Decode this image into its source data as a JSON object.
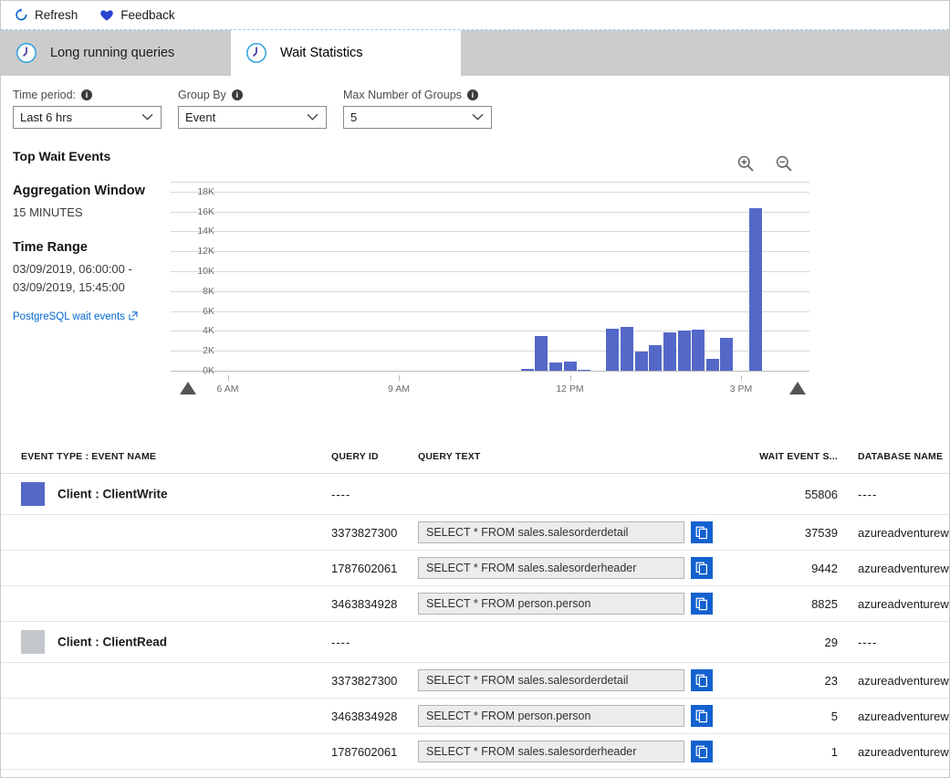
{
  "commandbar": {
    "refresh_label": "Refresh",
    "feedback_label": "Feedback"
  },
  "tabs": [
    {
      "label": "Long running queries",
      "icon": "clock-icon",
      "active": false
    },
    {
      "label": "Wait Statistics",
      "icon": "clock-icon",
      "active": true
    }
  ],
  "filters": {
    "time_period": {
      "label": "Time period:",
      "value": "Last 6 hrs"
    },
    "group_by": {
      "label": "Group By",
      "value": "Event"
    },
    "max_groups": {
      "label": "Max Number of Groups",
      "value": "5"
    }
  },
  "left_panel": {
    "title": "Top Wait Events",
    "aggregation_heading": "Aggregation Window",
    "aggregation_value": "15 MINUTES",
    "time_range_heading": "Time Range",
    "time_range_value": "03/09/2019, 06:00:00 - 03/09/2019, 15:45:00",
    "link_label": "PostgreSQL wait events"
  },
  "chart_controls": {
    "zoom_in": "zoom-in-icon",
    "zoom_out": "zoom-out-icon"
  },
  "chart_data": {
    "type": "bar",
    "title": "Top Wait Events",
    "xlabel": "",
    "ylabel": "",
    "ylim": [
      0,
      19000
    ],
    "yticks": [
      0,
      2000,
      4000,
      6000,
      8000,
      10000,
      12000,
      14000,
      16000,
      18000
    ],
    "ytick_labels": [
      "0K",
      "2K",
      "4K",
      "6K",
      "8K",
      "10K",
      "12K",
      "14K",
      "16K",
      "18K"
    ],
    "xtick_labels": [
      "6 AM",
      "9 AM",
      "12 PM",
      "3 PM"
    ],
    "xtick_positions": [
      6,
      9,
      12,
      15
    ],
    "x_range_hours": [
      5.0,
      16.2
    ],
    "grid": true,
    "legend": false,
    "bar_color": "#5468c8",
    "series": [
      {
        "name": "Client : ClientWrite",
        "bucket_minutes": 15,
        "x": [
          11.25,
          11.5,
          11.75,
          12.0,
          12.25,
          12.75,
          13.0,
          13.25,
          13.5,
          13.75,
          14.0,
          14.25,
          14.5,
          14.75,
          15.25
        ],
        "values": [
          180,
          3450,
          850,
          950,
          60,
          4200,
          4400,
          1900,
          2600,
          3900,
          4050,
          4150,
          1200,
          3350,
          16300
        ]
      }
    ]
  },
  "table": {
    "columns": [
      "EVENT TYPE : EVENT NAME",
      "QUERY ID",
      "QUERY TEXT",
      "WAIT EVENT S...",
      "DATABASE NAME"
    ],
    "rows": [
      {
        "kind": "group",
        "swatch": "#5468c8",
        "event": "Client : ClientWrite",
        "query_id": "----",
        "query_text": "",
        "wait": "55806",
        "database": "----"
      },
      {
        "kind": "detail",
        "event": "",
        "query_id": "3373827300",
        "query_text": "SELECT * FROM sales.salesorderdetail",
        "wait": "37539",
        "database": "azureadventurewor..."
      },
      {
        "kind": "detail",
        "event": "",
        "query_id": "1787602061",
        "query_text": "SELECT * FROM sales.salesorderheader",
        "wait": "9442",
        "database": "azureadventurewor..."
      },
      {
        "kind": "detail",
        "event": "",
        "query_id": "3463834928",
        "query_text": "SELECT * FROM person.person",
        "wait": "8825",
        "database": "azureadventurewor..."
      },
      {
        "kind": "group",
        "swatch": "#c3c6cb",
        "event": "Client : ClientRead",
        "query_id": "----",
        "query_text": "",
        "wait": "29",
        "database": "----"
      },
      {
        "kind": "detail",
        "event": "",
        "query_id": "3373827300",
        "query_text": "SELECT * FROM sales.salesorderdetail",
        "wait": "23",
        "database": "azureadventurewor..."
      },
      {
        "kind": "detail",
        "event": "",
        "query_id": "3463834928",
        "query_text": "SELECT * FROM person.person",
        "wait": "5",
        "database": "azureadventurewor..."
      },
      {
        "kind": "detail",
        "event": "",
        "query_id": "1787602061",
        "query_text": "SELECT * FROM sales.salesorderheader",
        "wait": "1",
        "database": "azureadventurewor..."
      }
    ]
  },
  "colors": {
    "accent": "#0066cc",
    "bar": "#5468c8",
    "copy_button": "#1361cf",
    "tab_inactive_bg": "#cccccc"
  }
}
